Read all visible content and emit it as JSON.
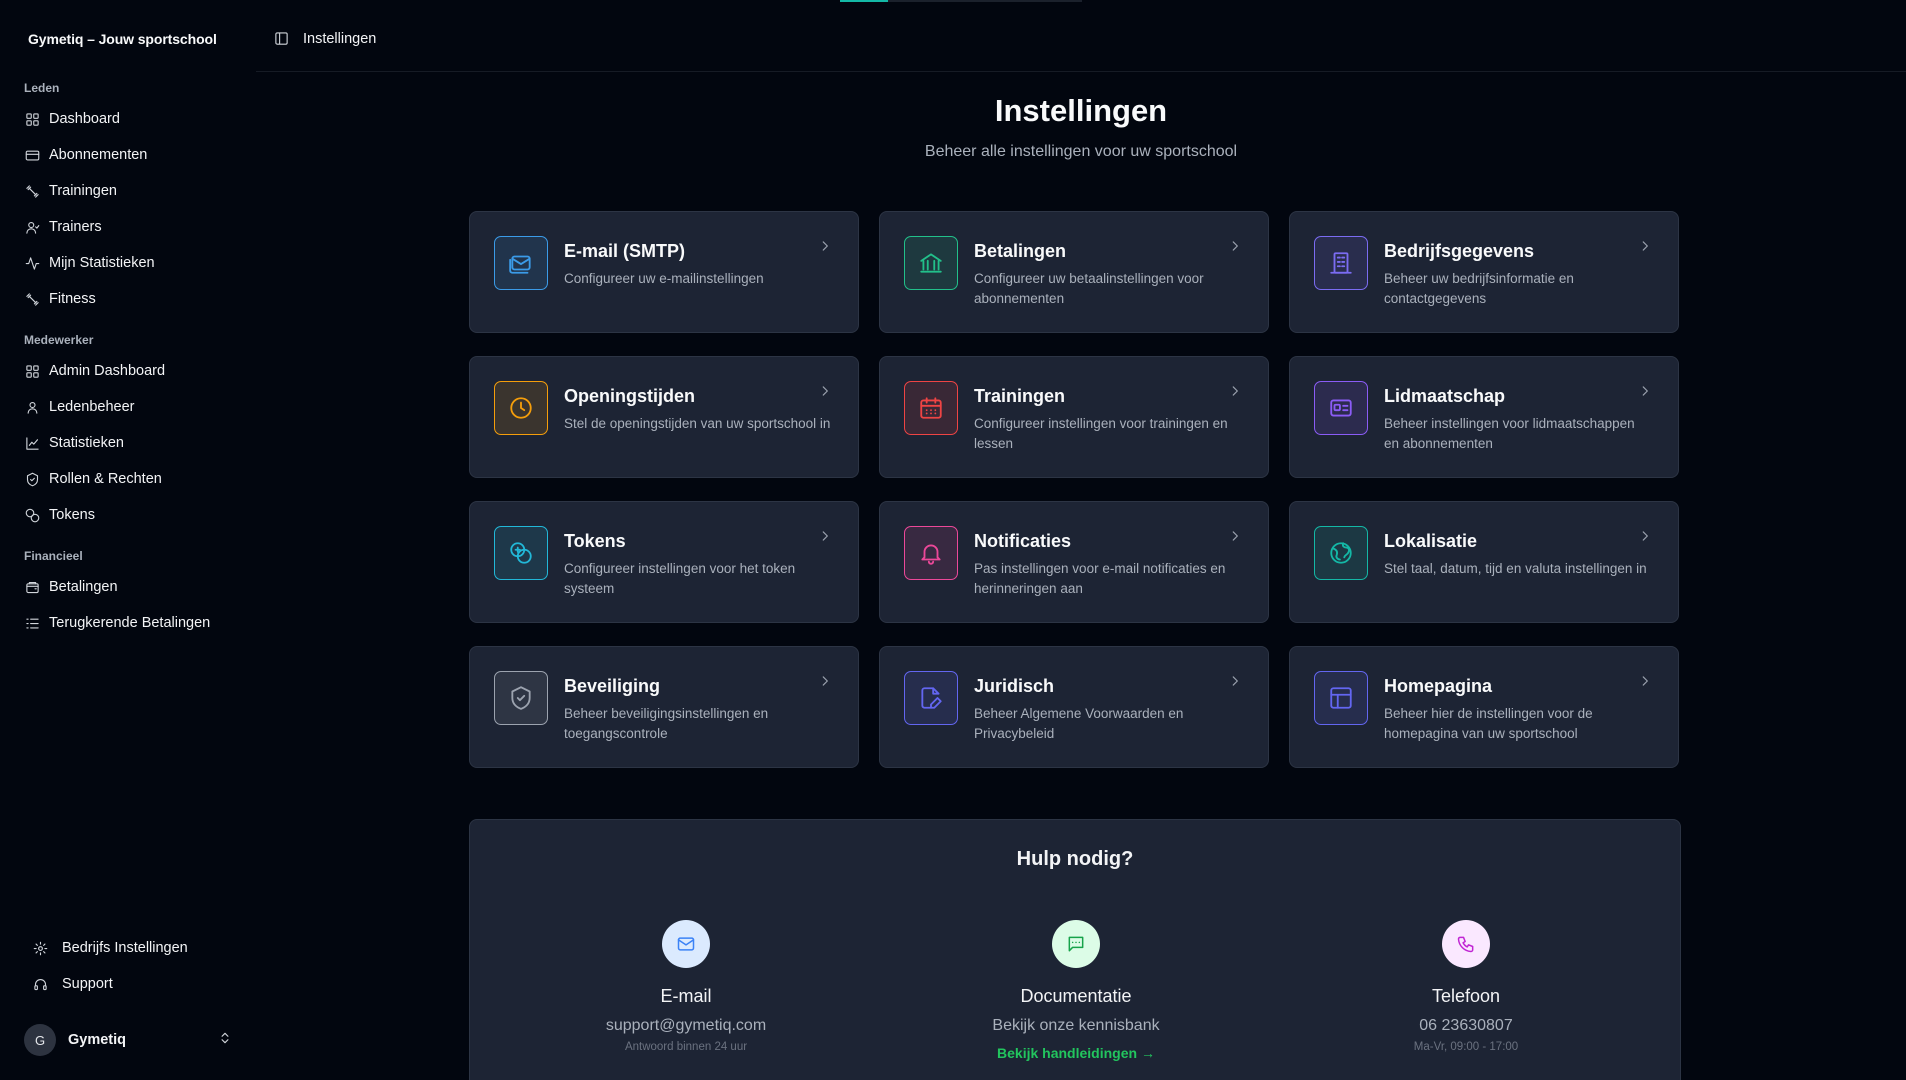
{
  "app": {
    "title": "Gymetiq – Jouw sportschool"
  },
  "sidebar": {
    "groups": [
      {
        "label": "Leden",
        "items": [
          {
            "label": "Dashboard",
            "icon": "grid-icon"
          },
          {
            "label": "Abonnementen",
            "icon": "card-icon"
          },
          {
            "label": "Trainingen",
            "icon": "dumbbell-icon"
          },
          {
            "label": "Trainers",
            "icon": "user-icon"
          },
          {
            "label": "Mijn Statistieken",
            "icon": "activity-icon"
          },
          {
            "label": "Fitness",
            "icon": "dumbbell-icon"
          }
        ]
      },
      {
        "label": "Medewerker",
        "items": [
          {
            "label": "Admin Dashboard",
            "icon": "grid-icon"
          },
          {
            "label": "Ledenbeheer",
            "icon": "user-icon"
          },
          {
            "label": "Statistieken",
            "icon": "chart-icon"
          },
          {
            "label": "Rollen & Rechten",
            "icon": "shield-icon"
          },
          {
            "label": "Tokens",
            "icon": "coins-icon"
          }
        ]
      },
      {
        "label": "Financieel",
        "items": [
          {
            "label": "Betalingen",
            "icon": "wallet-icon"
          },
          {
            "label": "Terugkerende Betalingen",
            "icon": "list-icon"
          }
        ]
      }
    ],
    "footer": [
      {
        "label": "Bedrijfs Instellingen",
        "icon": "gear-icon"
      },
      {
        "label": "Support",
        "icon": "headset-icon"
      }
    ],
    "user": {
      "initial": "G",
      "name": "Gymetiq"
    }
  },
  "header": {
    "breadcrumb": "Instellingen",
    "progress": 0.2
  },
  "main": {
    "title": "Instellingen",
    "subtitle": "Beheer alle instellingen voor uw sportschool",
    "cards": [
      {
        "title": "E-mail (SMTP)",
        "desc": "Configureer uw e-mailinstellingen",
        "icon": "mail-icon",
        "color": "#3b9be8"
      },
      {
        "title": "Betalingen",
        "desc": "Configureer uw betaalinstellingen voor abonnementen",
        "icon": "bank-icon",
        "color": "#22c08a"
      },
      {
        "title": "Bedrijfsgegevens",
        "desc": "Beheer uw bedrijfsinformatie en contactgegevens",
        "icon": "building-icon",
        "color": "#7b6cf2"
      },
      {
        "title": "Openingstijden",
        "desc": "Stel de openingstijden van uw sportschool in",
        "icon": "clock-icon",
        "color": "#f59e0b"
      },
      {
        "title": "Trainingen",
        "desc": "Configureer instellingen voor trainingen en lessen",
        "icon": "calendar-icon",
        "color": "#ef4444"
      },
      {
        "title": "Lidmaatschap",
        "desc": "Beheer instellingen voor lidmaatschappen en abonnementen",
        "icon": "id-card-icon",
        "color": "#8b5cf6"
      },
      {
        "title": "Tokens",
        "desc": "Configureer instellingen voor het token systeem",
        "icon": "coins-icon",
        "color": "#22b8d8"
      },
      {
        "title": "Notificaties",
        "desc": "Pas instellingen voor e-mail notificaties en herinneringen aan",
        "icon": "bell-icon",
        "color": "#ec4899"
      },
      {
        "title": "Lokalisatie",
        "desc": "Stel taal, datum, tijd en valuta instellingen in",
        "icon": "globe-icon",
        "color": "#14b8a6"
      },
      {
        "title": "Beveiliging",
        "desc": "Beheer beveiligingsinstellingen en toegangscontrole",
        "icon": "shield-check-icon",
        "color": "#9ca3af"
      },
      {
        "title": "Juridisch",
        "desc": "Beheer Algemene Voorwaarden en Privacybeleid",
        "icon": "file-edit-icon",
        "color": "#6366f1"
      },
      {
        "title": "Homepagina",
        "desc": "Beheer hier de instellingen voor de homepagina van uw sportschool",
        "icon": "layout-icon",
        "color": "#6366f1"
      }
    ]
  },
  "help": {
    "title": "Hulp nodig?",
    "columns": [
      {
        "name": "E-mail",
        "value": "support@gymetiq.com",
        "note": "Antwoord binnen 24 uur",
        "link": "",
        "icon": "mail-icon",
        "color": "#3b82f6",
        "bg": "#dbeafe"
      },
      {
        "name": "Documentatie",
        "value": "Bekijk onze kennisbank",
        "note": "",
        "link": "Bekijk handleidingen →",
        "icon": "chat-icon",
        "color": "#16a34a",
        "bg": "#dcfce7"
      },
      {
        "name": "Telefoon",
        "value": "06 23630807",
        "note": "Ma-Vr, 09:00 - 17:00",
        "link": "",
        "icon": "phone-icon",
        "color": "#c026d3",
        "bg": "#fae8ff"
      }
    ]
  }
}
